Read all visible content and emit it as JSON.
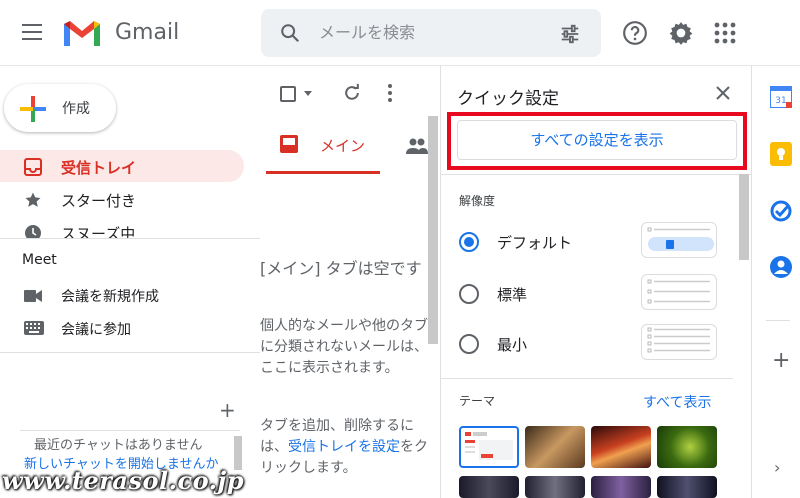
{
  "header": {
    "app_name": "Gmail",
    "search_placeholder": "メールを検索"
  },
  "sidebar": {
    "compose_label": "作成",
    "items": [
      {
        "label": "受信トレイ",
        "icon": "inbox-icon",
        "active": true
      },
      {
        "label": "スター付き",
        "icon": "star-icon"
      },
      {
        "label": "スヌーズ中",
        "icon": "clock-icon"
      }
    ],
    "meet": {
      "title": "Meet",
      "items": [
        {
          "label": "会議を新規作成",
          "icon": "video-icon"
        },
        {
          "label": "会議に参加",
          "icon": "keyboard-icon"
        }
      ]
    },
    "chat": {
      "add": "+",
      "empty_text": "最近のチャットはありません",
      "start_link": "新しいチャットを開始しませんか"
    }
  },
  "mail": {
    "tab_main": "メイン",
    "empty_title": "[メイン] タブは空です",
    "empty_desc": "個人的なメールや他のタブに分類されないメールは、ここに表示されます。",
    "empty_desc2_pre": "タブを追加、削除するには、",
    "empty_desc2_link": "受信トレイを設定",
    "empty_desc2_post": "をクリックします。"
  },
  "quick_settings": {
    "title": "クイック設定",
    "all_settings_button": "すべての設定を表示",
    "density_title": "解像度",
    "density_options": [
      {
        "label": "デフォルト",
        "checked": true
      },
      {
        "label": "標準",
        "checked": false
      },
      {
        "label": "最小",
        "checked": false
      }
    ],
    "theme_title": "テーマ",
    "theme_all": "すべて表示",
    "highlight_color": "#e8091e"
  },
  "right_rail": {
    "add": "+",
    "expand": "›",
    "calendar_day": "31"
  },
  "watermark": "www.terasol.co.jp"
}
